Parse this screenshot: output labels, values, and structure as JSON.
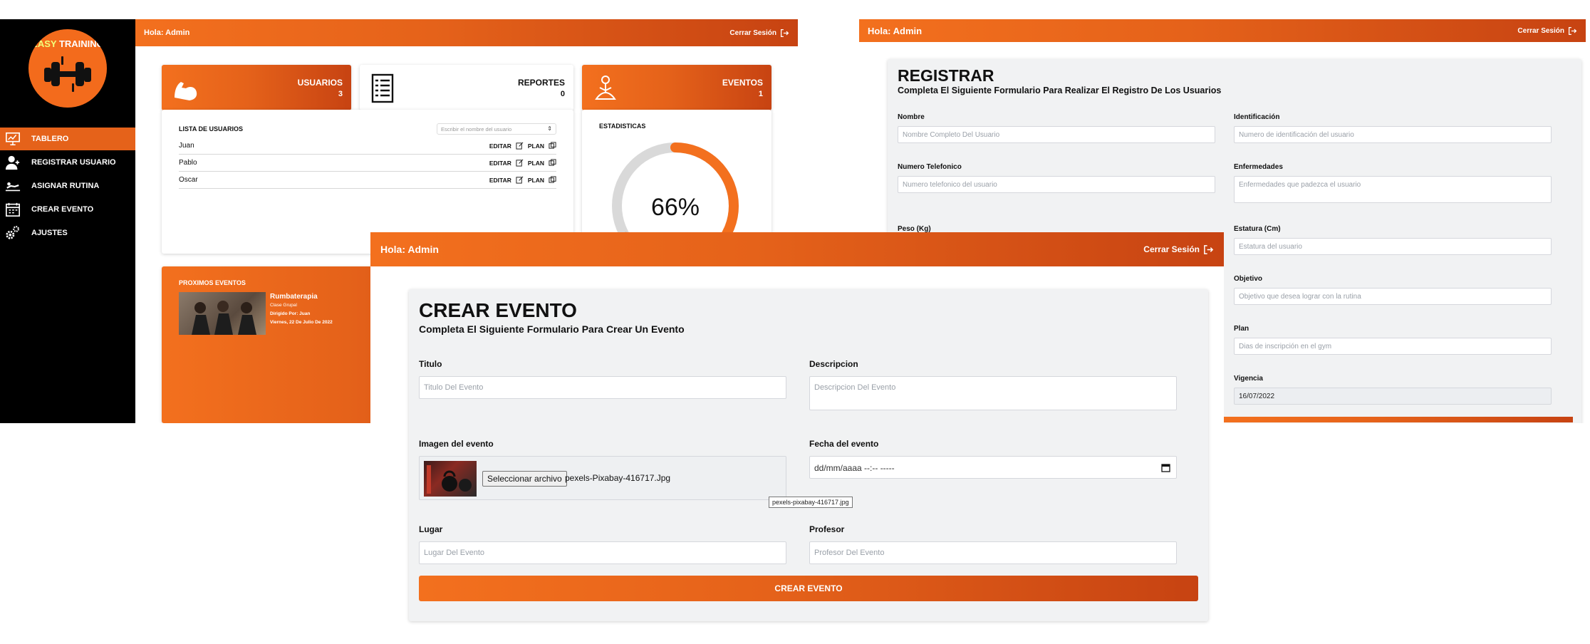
{
  "dashboard": {
    "greeting": "Hola: Admin",
    "logout_label": "Cerrar Sesión",
    "logo": {
      "word1": "EASY",
      "word2": "TRAINING"
    },
    "nav": [
      {
        "label": "TABLERO",
        "icon": "dashboard-icon"
      },
      {
        "label": "REGISTRAR USUARIO",
        "icon": "add-user-icon"
      },
      {
        "label": "ASIGNAR RUTINA",
        "icon": "workout-icon"
      },
      {
        "label": "CREAR EVENTO",
        "icon": "calendar-icon"
      },
      {
        "label": "AJUSTES",
        "icon": "gears-icon"
      }
    ],
    "stats": [
      {
        "title": "USUARIOS",
        "value": "3",
        "icon": "muscle-arm-icon"
      },
      {
        "title": "REPORTES",
        "value": "0",
        "icon": "checklist-icon"
      },
      {
        "title": "EVENTOS",
        "value": "1",
        "icon": "yoga-icon"
      }
    ],
    "user_list": {
      "title": "LISTA DE USUARIOS",
      "search_placeholder": "Escribir el nombre del usuario",
      "edit_label": "EDITAR",
      "plan_label": "PLAN",
      "users": [
        "Juan",
        "Pablo",
        "Oscar"
      ]
    },
    "statistics": {
      "title": "ESTADISTICAS",
      "percent_text": "66%",
      "percent_value": 66
    },
    "upcoming": {
      "title": "PROXIMOS EVENTOS",
      "event_name": "Rumbaterapia",
      "event_type": "Clase Grupal",
      "event_leader": "Dirigido Por: Juan",
      "event_date": "Viernes, 22 De Julio De 2022"
    },
    "colors": {
      "accent": "#f3701e",
      "accent_dark": "#c74312",
      "sidebar": "#000000"
    }
  },
  "registrar": {
    "greeting": "Hola: Admin",
    "logout_label": "Cerrar Sesión",
    "title": "REGISTRAR",
    "subtitle": "Completa El Siguiente Formulario Para Realizar El Registro De Los Usuarios",
    "fields": {
      "nombre": {
        "label": "Nombre",
        "placeholder": "Nombre Completo Del Usuario"
      },
      "identificacion": {
        "label": "Identificación",
        "placeholder": "Numero de identificación del usuario"
      },
      "telefono": {
        "label": "Numero Telefonico",
        "placeholder": "Numero telefonico del usuario"
      },
      "enfermedades": {
        "label": "Enfermedades",
        "placeholder": "Enfermedades que padezca el usuario"
      },
      "peso": {
        "label": "Peso (Kg)"
      },
      "estatura": {
        "label": "Estatura (Cm)",
        "placeholder": "Estatura del usuario"
      },
      "objetivo": {
        "label": "Objetivo",
        "placeholder": "Objetivo que desea lograr con la rutina"
      },
      "plan": {
        "label": "Plan",
        "placeholder": "Dias de inscripción en el gym"
      },
      "vigencia": {
        "label": "Vigencia",
        "value": "16/07/2022"
      }
    }
  },
  "crear_evento": {
    "greeting": "Hola: Admin",
    "logout_label": "Cerrar Sesión",
    "title": "CREAR EVENTO",
    "subtitle": "Completa El Siguiente Formulario Para Crear Un Evento",
    "fields": {
      "titulo": {
        "label": "Titulo",
        "placeholder": "Titulo Del Evento"
      },
      "descripcion": {
        "label": "Descripcion",
        "placeholder": "Descripcion Del Evento"
      },
      "imagen": {
        "label": "Imagen del evento",
        "button": "Seleccionar archivo",
        "filename": "pexels-Pixabay-416717.Jpg",
        "tooltip": "pexels-pixabay-416717.jpg"
      },
      "fecha": {
        "label": "Fecha del evento",
        "placeholder": "dd/mm/aaaa --:-- -----"
      },
      "lugar": {
        "label": "Lugar",
        "placeholder": "Lugar Del Evento"
      },
      "profesor": {
        "label": "Profesor",
        "placeholder": "Profesor Del Evento"
      }
    },
    "submit_label": "CREAR EVENTO"
  }
}
